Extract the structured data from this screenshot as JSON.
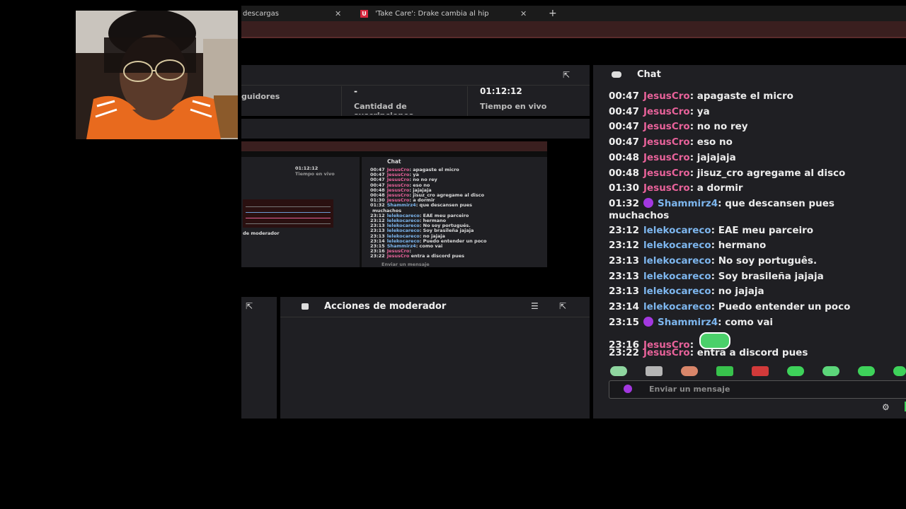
{
  "browser": {
    "tabs": [
      {
        "label": "descargas",
        "close": "✕"
      },
      {
        "label": "'Take Care': Drake cambia al hip",
        "close": "✕"
      }
    ],
    "new_tab": "+"
  },
  "stats": {
    "cells": [
      {
        "value": "",
        "label": "guidores"
      },
      {
        "value": "-",
        "label": "Cantidad de suscripciones"
      },
      {
        "value": "01:12:12",
        "label": "Tiempo en vivo"
      }
    ]
  },
  "chat": {
    "title": "Chat",
    "input_placeholder": "Enviar un mensaje",
    "messages": [
      {
        "time": "00:47",
        "user": "JesusCro",
        "text": ": apagaste el micro",
        "color": "pink"
      },
      {
        "time": "00:47",
        "user": "JesusCro",
        "text": ": ya",
        "color": "pink"
      },
      {
        "time": "00:47",
        "user": "JesusCro",
        "text": ": no no rey",
        "color": "pink"
      },
      {
        "time": "00:47",
        "user": "JesusCro",
        "text": ": eso no",
        "color": "pink"
      },
      {
        "time": "00:48",
        "user": "JesusCro",
        "text": ": jajajaja",
        "color": "pink"
      },
      {
        "time": "00:48",
        "user": "JesusCro",
        "text": ": jisuz_cro agregame al disco",
        "color": "pink"
      },
      {
        "time": "01:30",
        "user": "JesusCro",
        "text": ": a dormir",
        "color": "pink"
      },
      {
        "time": "01:32",
        "user": "Shammirz4",
        "text": ": que descansen pues",
        "text2": "muchachos",
        "color": "blue",
        "badge": true
      },
      {
        "time": "23:12",
        "user": "lelekocareco",
        "text": ": EAE meu parceiro",
        "color": "blue"
      },
      {
        "time": "23:12",
        "user": "lelekocareco",
        "text": ": hermano",
        "color": "blue"
      },
      {
        "time": "23:13",
        "user": "lelekocareco",
        "text": ": No soy português.",
        "color": "blue"
      },
      {
        "time": "23:13",
        "user": "lelekocareco",
        "text": ": Soy brasileña jajaja",
        "color": "blue"
      },
      {
        "time": "23:13",
        "user": "lelekocareco",
        "text": ": no jajaja",
        "color": "blue"
      },
      {
        "time": "23:14",
        "user": "lelekocareco",
        "text": ": Puedo entender un poco",
        "color": "blue"
      },
      {
        "time": "23:15",
        "user": "Shammirz4",
        "text": ": como vai",
        "color": "blue",
        "badge": true
      },
      {
        "time": "23:16",
        "user": "JesusCro",
        "text": ":",
        "color": "pink",
        "emote": true
      },
      {
        "time": "23:22",
        "user": "JesusCro",
        "text": ": entra a discord pues",
        "color": "pink"
      }
    ]
  },
  "thumbnail": {
    "chat_title": "Chat",
    "time_live": "01:12:12",
    "time_label": "Tiempo en vivo",
    "mod_label": "de moderador",
    "input": "Enviar un mensaje",
    "lines": [
      {
        "t": "00:47",
        "u": "JesusCro",
        "m": ": apagaste el micro",
        "c": "pink"
      },
      {
        "t": "00:47",
        "u": "JesusCro",
        "m": ": ya",
        "c": "pink"
      },
      {
        "t": "00:47",
        "u": "JesusCro",
        "m": ": no no rey",
        "c": "pink"
      },
      {
        "t": "00:47",
        "u": "JesusCro",
        "m": ": eso no",
        "c": "pink"
      },
      {
        "t": "00:48",
        "u": "JesusCro",
        "m": ": jajajaja",
        "c": "pink"
      },
      {
        "t": "00:48",
        "u": "JesusCro",
        "m": ": jisuz_cro agregame al disco",
        "c": "pink"
      },
      {
        "t": "01:30",
        "u": "JesusCro",
        "m": ": a dormir",
        "c": "pink"
      },
      {
        "t": "01:32",
        "u": "Shammirz4",
        "m": ": que descansen pues",
        "c": "blue"
      },
      {
        "t": "",
        "u": "",
        "m": "muchachos",
        "c": "white"
      },
      {
        "t": "23:12",
        "u": "lelekocareco",
        "m": ": EAE meu parceiro",
        "c": "blue"
      },
      {
        "t": "23:12",
        "u": "lelekocareco",
        "m": ": hermano",
        "c": "blue"
      },
      {
        "t": "23:13",
        "u": "lelekocareco",
        "m": ": No soy portugués.",
        "c": "blue"
      },
      {
        "t": "23:13",
        "u": "lelekocareco",
        "m": ": Soy brasileña jajaja",
        "c": "blue"
      },
      {
        "t": "23:13",
        "u": "lelekocareco",
        "m": ": no jajaja",
        "c": "blue"
      },
      {
        "t": "23:14",
        "u": "lelekocareco",
        "m": ": Puedo entender un poco",
        "c": "blue"
      },
      {
        "t": "23:15",
        "u": "Shammirz4",
        "m": ": como vai",
        "c": "blue"
      },
      {
        "t": "23:16",
        "u": "JesusCro",
        "m": ":",
        "c": "pink"
      },
      {
        "t": "23:22",
        "u": "JesusCro",
        "m": " entra a discord pues",
        "c": "pink"
      }
    ]
  },
  "mod": {
    "title": "Acciones de moderador"
  },
  "colors": {
    "pink": "#e8629a",
    "blue": "#7db6ee",
    "panel": "#1f1f23",
    "badge": "#a338e0",
    "emote": "#3ed25a"
  }
}
